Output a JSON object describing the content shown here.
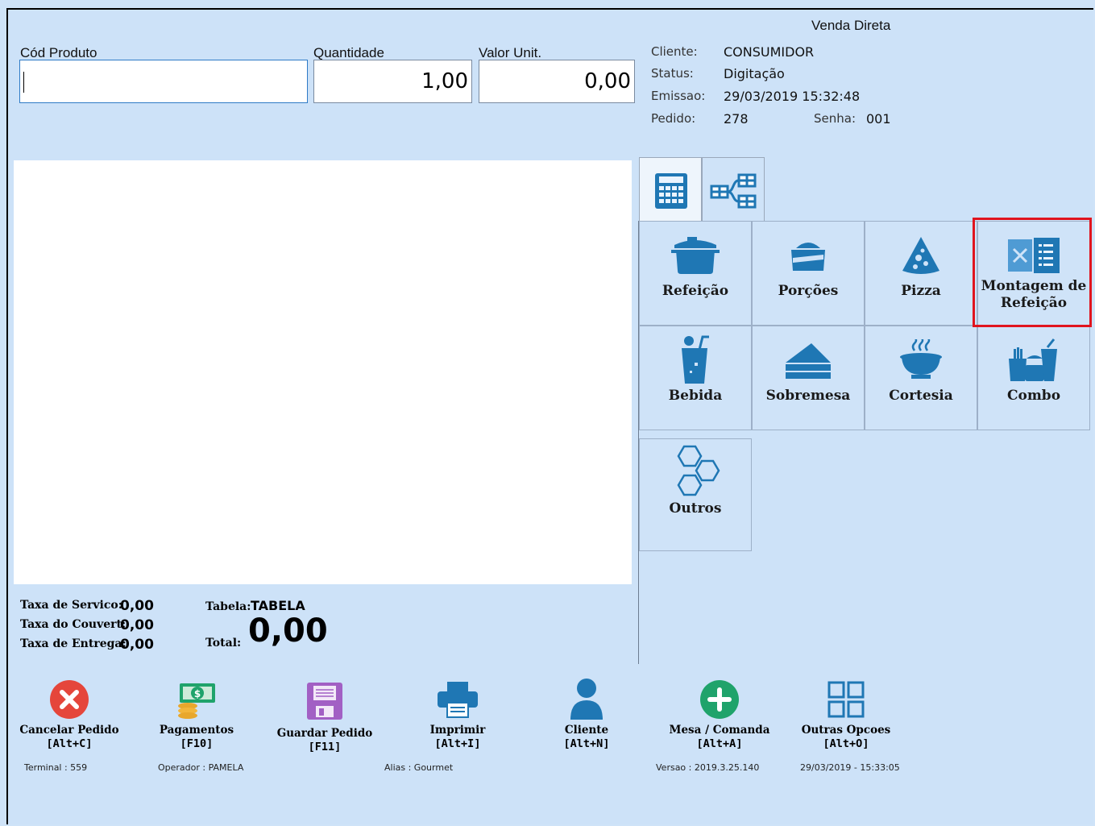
{
  "header": {
    "mode": "Venda Direta"
  },
  "fields": {
    "product_code_label": "Cód Produto",
    "product_code_value": "",
    "quantity_label": "Quantidade",
    "quantity_value": "1,00",
    "unit_value_label": "Valor Unit.",
    "unit_value_value": "0,00"
  },
  "info": {
    "client_label": "Cliente:",
    "client_value": "CONSUMIDOR",
    "status_label": "Status:",
    "status_value": "Digitação",
    "emission_label": "Emissao:",
    "emission_value": "29/03/2019 15:32:48",
    "order_label": "Pedido:",
    "order_value": "278",
    "password_label": "Senha:",
    "password_value": "001"
  },
  "tabs": [
    {
      "icon": "calculator-icon"
    },
    {
      "icon": "table-tree-icon"
    }
  ],
  "categories": [
    {
      "label": "Refeição",
      "icon": "pot-icon"
    },
    {
      "label": "Porções",
      "icon": "portion-icon"
    },
    {
      "label": "Pizza",
      "icon": "pizza-icon"
    },
    {
      "label": "Montagem de Refeição",
      "icon": "menu-cutlery-icon"
    },
    {
      "label": "Bebida",
      "icon": "drink-icon"
    },
    {
      "label": "Sobremesa",
      "icon": "cake-icon"
    },
    {
      "label": "Cortesia",
      "icon": "hot-dish-icon"
    },
    {
      "label": "Combo",
      "icon": "combo-icon"
    },
    {
      "label": "Outros",
      "icon": "hexagons-icon"
    }
  ],
  "totals": {
    "service_fee_label": "Taxa de Servico:",
    "service_fee_value": "0,00",
    "couvert_fee_label": "Taxa do Couvert:",
    "couvert_fee_value": "0,00",
    "delivery_fee_label": "Taxa de Entrega:",
    "delivery_fee_value": "0,00",
    "table_label": "Tabela:",
    "table_value": "TABELA",
    "total_label": "Total:",
    "total_value": "0,00"
  },
  "actions": [
    {
      "title": "Cancelar Pedido",
      "key": "[Alt+C]",
      "icon": "cancel-icon"
    },
    {
      "title": "Pagamentos",
      "key": "[F10]",
      "icon": "money-icon"
    },
    {
      "title": "Guardar Pedido",
      "key": "[F11]",
      "icon": "save-icon"
    },
    {
      "title": "Imprimir",
      "key": "[Alt+I]",
      "icon": "printer-icon"
    },
    {
      "title": "Cliente",
      "key": "[Alt+N]",
      "icon": "user-icon"
    },
    {
      "title": "Mesa / Comanda",
      "key": "[Alt+A]",
      "icon": "add-icon"
    },
    {
      "title": "Outras Opcoes",
      "key": "[Alt+O]",
      "icon": "grid-icon"
    }
  ],
  "footer": {
    "terminal": "Terminal : 559",
    "operator": "Operador : PAMELA",
    "alias": "Alias : Gourmet",
    "version": "Versao : 2019.3.25.140",
    "datetime": "29/03/2019 - 15:33:05"
  },
  "colors": {
    "background": "#cfe3f8",
    "icon_blue": "#1f77b4",
    "highlight": "#e0141e",
    "cancel_red": "#e5463b",
    "add_green": "#1fa36b",
    "save_purple": "#a260c4"
  }
}
